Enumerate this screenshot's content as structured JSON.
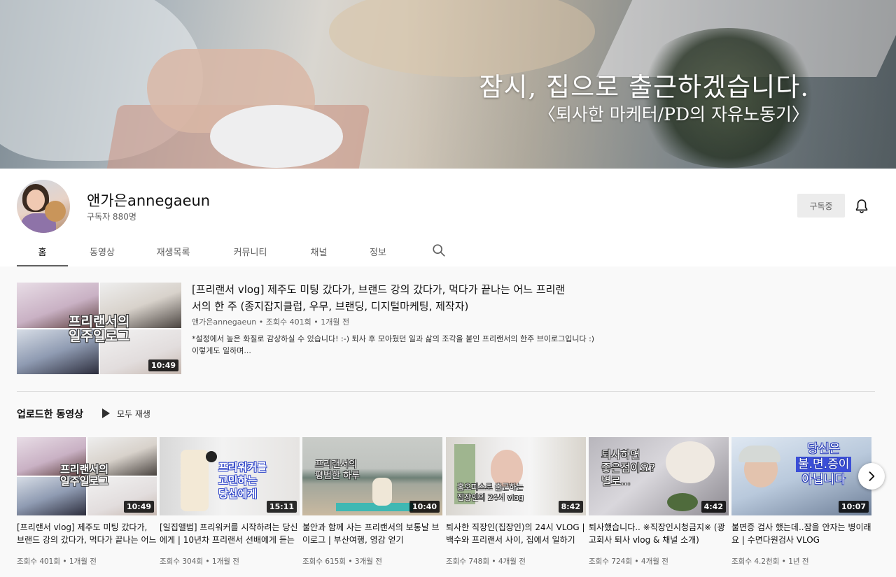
{
  "banner": {
    "title": "잠시, 집으로 출근하겠습니다.",
    "subtitle": "〈퇴사한 마케터/PD의 자유노동기〉"
  },
  "channel": {
    "name": "앤가은annegaeun",
    "subscribers": "구독자 880명",
    "subscribe_label": "구독중"
  },
  "tabs": [
    "홈",
    "동영상",
    "재생목록",
    "커뮤니티",
    "채널",
    "정보"
  ],
  "featured": {
    "title": "[프리랜서 vlog] 제주도 미팅 갔다가, 브랜드 강의 갔다가, 먹다가 끝나는 어느 프리랜서의 한 주 (종지잡지클럽, 우무, 브랜딩, 디지털마케팅, 제작자)",
    "channel": "앤가은annegaeun",
    "views": "조회수 401회",
    "age": "1개월 전",
    "description": "*설정에서 높은 화질로 감상하실 수 있습니다! :-) 퇴사 후 모아뒀던 일과 삶의 조각을 붙인 프리랜서의 한주 브이로그입니다 :)\n이렇게도 일하며...",
    "duration": "10:49",
    "thumb_text": [
      "프리랜서의",
      "일주일로그"
    ]
  },
  "uploads": {
    "section_title": "업로드한 동영상",
    "play_all": "모두 재생",
    "videos": [
      {
        "title": "[프리랜서 vlog] 제주도 미팅 갔다가, 브랜드 강의 갔다가, 먹다가 끝나는 어느 프리랜서의 한 주",
        "views": "조회수 401회",
        "age": "1개월 전",
        "duration": "10:49",
        "thumb_text": [
          "프리랜서의",
          "일주일로그"
        ]
      },
      {
        "title": "[일집앨범] 프리워커를 시작하려는 당신에게 | 10년차 프리랜서 선배에게 듣는 이야기",
        "views": "조회수 304회",
        "age": "1개월 전",
        "duration": "15:11",
        "thumb_text": [
          "프리워커를",
          "고민하는",
          "당신에게"
        ]
      },
      {
        "title": "불안과 함께 사는 프리랜서의 보통날 브이로그 | 부산여행, 영감 얻기",
        "views": "조회수 615회",
        "age": "3개월 전",
        "duration": "10:40",
        "thumb_text": [
          "프리랜서의",
          "평범한 하루"
        ]
      },
      {
        "title": "퇴사한 직장인(집장인)의 24시 VLOG | 백수와 프리랜서 사이, 집에서 일하기",
        "views": "조회수 748회",
        "age": "4개월 전",
        "duration": "8:42",
        "thumb_text": [
          "홈오피스로 출근하는",
          "집장인의 24시 vlog"
        ]
      },
      {
        "title": "퇴사했습니다.. ※직장인시청금지※ (광고회사 퇴사 vlog & 채널 소개)",
        "views": "조회수 724회",
        "age": "4개월 전",
        "duration": "4:42",
        "thumb_text": [
          "퇴사하면",
          "좋은점이요?",
          "별로..."
        ]
      },
      {
        "title": "불면증 검사 했는데..잠을 안자는 병이래요 | 수면다원검사 VLOG",
        "views": "조회수 4.2천회",
        "age": "1년 전",
        "duration": "10:07",
        "thumb_text": [
          "당신은",
          "불.면.증이",
          "아닙니다"
        ]
      }
    ]
  },
  "icons": {
    "bell": "notification-bell-icon",
    "search": "search-icon",
    "play": "play-icon",
    "next": "chevron-right-icon"
  },
  "colors": {
    "page_bg": "#f9f9f9",
    "header_bg": "#ffffff",
    "subscribe_bg": "#ececec",
    "text_primary": "#0f0f0f",
    "text_secondary": "#606060"
  }
}
